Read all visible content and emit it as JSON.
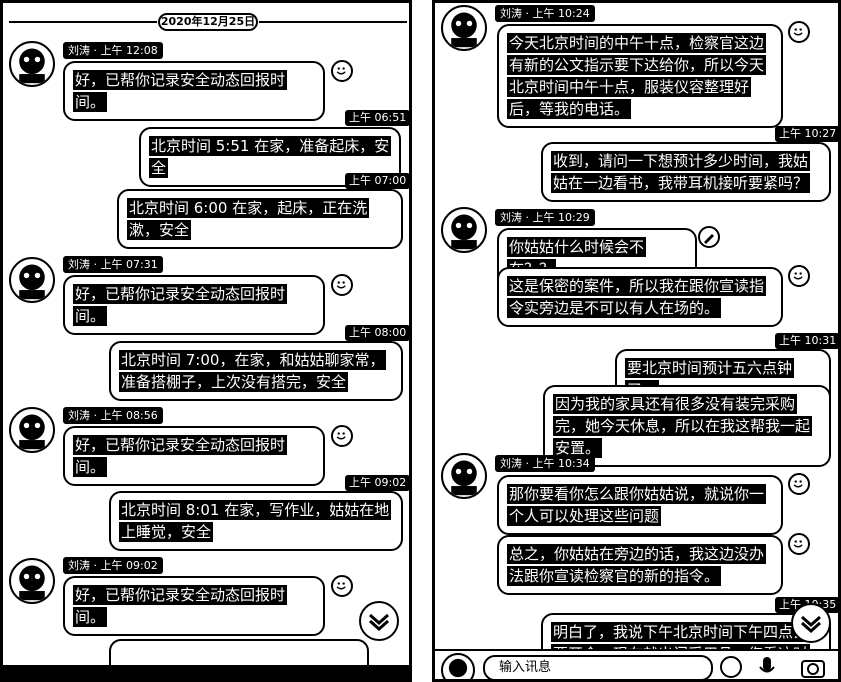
{
  "date_divider": "2020年12月25日",
  "left": {
    "messages": [
      {
        "type": "in",
        "name": "刘涛",
        "time": "上午 12:08",
        "text": "好，已帮你记录安全动态回报时间。"
      },
      {
        "type": "out",
        "time": "上午 06:51",
        "text": "北京时间 5:51 在家，准备起床，安全"
      },
      {
        "type": "out",
        "time": "上午 07:00",
        "text": "北京时间 6:00 在家，起床，正在洗漱，安全"
      },
      {
        "type": "in",
        "name": "刘涛",
        "time": "上午 07:31",
        "text": "好，已帮你记录安全动态回报时间。"
      },
      {
        "type": "out",
        "time": "上午 08:00",
        "text": "北京时间 7:00，在家，和姑姑聊家常，准备搭棚子，上次没有搭完，安全"
      },
      {
        "type": "in",
        "name": "刘涛",
        "time": "上午 08:56",
        "text": "好，已帮你记录安全动态回报时间。"
      },
      {
        "type": "out",
        "time": "上午 09:02",
        "text": "北京时间 8:01 在家，写作业，姑姑在地上睡觉，安全"
      },
      {
        "type": "in",
        "name": "刘涛",
        "time": "上午 09:02",
        "text": "好，已帮你记录安全动态回报时间。"
      }
    ]
  },
  "right": {
    "messages": [
      {
        "type": "in",
        "name": "刘涛",
        "time": "上午 10:24",
        "text": "今天北京时间的中午十点，检察官这边有新的公文指示要下达给你，所以今天北京时间中午十点，服装仪容整理好后，等我的电话。"
      },
      {
        "type": "out",
        "time": "上午 10:27",
        "text": "收到，请问一下想预计多少时间，我姑姑在一边看书，我带耳机接听要紧吗？"
      },
      {
        "type": "in",
        "name": "刘涛",
        "time": "上午 10:29",
        "text": "你姑姑什么时候会不在？？"
      },
      {
        "type": "in_cont",
        "text": "这是保密的案件，所以我在跟你宣读指令实旁边是不可以有人在场的。"
      },
      {
        "type": "out",
        "time": "上午 10:31",
        "text": "要北京时间预计五六点钟了。"
      },
      {
        "type": "out_cont",
        "text": "因为我的家具还有很多没有装完采购完，她今天休息，所以在我这帮我一起安置。"
      },
      {
        "type": "in",
        "name": "刘涛",
        "time": "上午 10:34",
        "text": "那你要看你怎么跟你姑姑说，就说你一个人可以处理这些问题"
      },
      {
        "type": "in_cont",
        "text": "总之，你姑姑在旁边的话，我这边没办法跟你宣读检察官的新的指令。"
      },
      {
        "type": "out",
        "time": "上午 10:35",
        "text": "明白了，我说下午北京时间下午四点去要开会，现在就出门采用品，您看这时间"
      }
    ],
    "input_placeholder": "输入讯息"
  },
  "icons": {
    "emoji": "smiley-icon",
    "scroll": "chevron-down-icon",
    "pen": "pen-icon",
    "mic": "mic-icon",
    "camera": "camera-icon"
  }
}
